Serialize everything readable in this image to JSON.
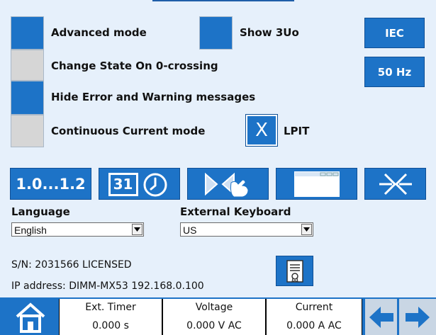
{
  "options": {
    "advanced_mode": {
      "label": "Advanced mode",
      "state": "on"
    },
    "show_3uo": {
      "label": "Show 3Uo",
      "state": "on"
    },
    "change_state": {
      "label": "Change State On 0-crossing",
      "state": "off"
    },
    "hide_errors": {
      "label": "Hide Error and Warning messages",
      "state": "on"
    },
    "continuous_current": {
      "label": "Continuous Current mode",
      "state": "off"
    },
    "lpit": {
      "label": "LPIT",
      "mark": "X"
    }
  },
  "side_buttons": {
    "standard": "IEC",
    "frequency": "50 Hz"
  },
  "toolbar": {
    "range_label": "1.0...1.2",
    "calendar_label": "31"
  },
  "language": {
    "label": "Language",
    "value": "English"
  },
  "keyboard": {
    "label": "External Keyboard",
    "value": "US"
  },
  "device": {
    "serial": "S/N: 2031566  LICENSED",
    "ip": "IP address: DIMM-MX53 192.168.0.100"
  },
  "status_bar": {
    "ext_timer": {
      "title": "Ext. Timer",
      "value": "0.000 s"
    },
    "voltage": {
      "title": "Voltage",
      "value": "0.000 V AC"
    },
    "current": {
      "title": "Current",
      "value": "0.000 A AC"
    }
  },
  "colors": {
    "accent": "#1d73c7",
    "background": "#e6f0fb",
    "toggle_off": "#d6d6d6"
  }
}
